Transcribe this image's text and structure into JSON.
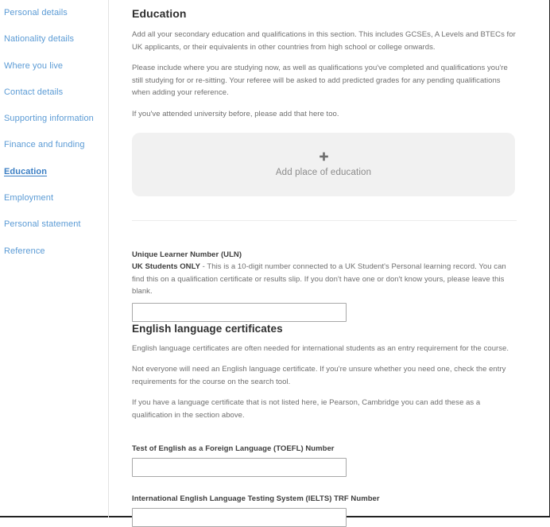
{
  "sidebar": {
    "items": [
      {
        "label": "Personal details",
        "active": false
      },
      {
        "label": "Nationality details",
        "active": false
      },
      {
        "label": "Where you live",
        "active": false
      },
      {
        "label": "Contact details",
        "active": false
      },
      {
        "label": "Supporting information",
        "active": false
      },
      {
        "label": "Finance and funding",
        "active": false
      },
      {
        "label": "Education",
        "active": true
      },
      {
        "label": "Employment",
        "active": false
      },
      {
        "label": "Personal statement",
        "active": false
      },
      {
        "label": "Reference",
        "active": false
      }
    ]
  },
  "main": {
    "education": {
      "title": "Education",
      "paragraph1": "Add all your secondary education and qualifications in this section. This includes GCSEs, A Levels and BTECs for UK applicants, or their equivalents in other countries from high school or college onwards.",
      "paragraph2": "Please include where you are studying now, as well as qualifications you've completed and qualifications you're still studying for or re-sitting. Your referee will be asked to add predicted grades for any pending qualifications when adding your reference.",
      "paragraph3": "If you've attended university before, please add that here too.",
      "add_card": {
        "icon": "plus-icon",
        "plus_glyph": "✛",
        "label": "Add place of education"
      }
    },
    "uln": {
      "label": "Unique Learner Number (ULN)",
      "helper_bold": "UK Students ONLY",
      "helper_rest": " - This is a 10-digit number connected to a UK Student's Personal learning record. You can find this on a qualification certificate or results slip. If you don't have one or don't know yours, please leave this blank.",
      "value": "",
      "placeholder": ""
    },
    "english": {
      "title": "English language certificates",
      "paragraph1": "English language certificates are often needed for international students as an entry requirement for the course.",
      "paragraph2": "Not everyone will need an English language certificate. If you're unsure whether you need one, check the entry requirements for the course on the search tool.",
      "paragraph3": "If you have a language certificate that is not listed here, ie Pearson, Cambridge you can add these as a qualification in the section above.",
      "toefl": {
        "label": "Test of English as a Foreign Language (TOEFL) Number",
        "value": "",
        "placeholder": ""
      },
      "ielts": {
        "label": "International English Language Testing System (IELTS) TRF Number",
        "value": "",
        "placeholder": ""
      }
    }
  },
  "colors": {
    "link": "#5b9bd5",
    "active_link": "#3c7fc4",
    "body_text": "#6f6f6f",
    "heading": "#2f2f2f",
    "card_bg": "#f1f1f1",
    "input_border": "#a8a8a8"
  }
}
